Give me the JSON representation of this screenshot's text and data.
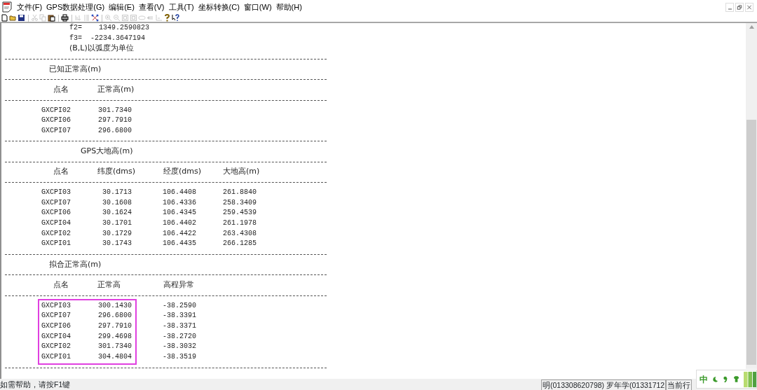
{
  "menu": [
    "文件(F)",
    "GPS数据处理(G)",
    "编辑(E)",
    "查看(V)",
    "工具(T)",
    "坐标转换(C)",
    "窗口(W)",
    "帮助(H)"
  ],
  "toolbar": [
    {
      "kind": "new",
      "disabled": false
    },
    {
      "kind": "open",
      "disabled": false
    },
    {
      "kind": "save",
      "disabled": false
    },
    {
      "kind": "separator"
    },
    {
      "kind": "cut",
      "disabled": true
    },
    {
      "kind": "copy",
      "disabled": true
    },
    {
      "kind": "paste",
      "disabled": false
    },
    {
      "kind": "separator"
    },
    {
      "kind": "print",
      "disabled": false
    },
    {
      "kind": "separator"
    },
    {
      "kind": "sort",
      "disabled": true
    },
    {
      "kind": "columns",
      "disabled": true
    },
    {
      "kind": "network",
      "disabled": false
    },
    {
      "kind": "separator"
    },
    {
      "kind": "zoom-in",
      "disabled": true
    },
    {
      "kind": "zoom-out",
      "disabled": true
    },
    {
      "kind": "frame",
      "disabled": true
    },
    {
      "kind": "frame",
      "disabled": true
    },
    {
      "kind": "ellipse",
      "disabled": true
    },
    {
      "kind": "arrows",
      "disabled": true
    },
    {
      "kind": "axis",
      "disabled": true
    },
    {
      "kind": "help",
      "disabled": false
    },
    {
      "kind": "context-help",
      "disabled": false
    }
  ],
  "report": {
    "header_lines": [
      "f2=    1349.2590823",
      "f3=  -2234.3647194",
      "(B,L)以弧度为单位"
    ],
    "sections": [
      {
        "title": "已知正常高(m)",
        "columns": [
          "点名",
          "正常高(m)"
        ],
        "rows": [
          [
            "GXCPI02",
            "301.7340"
          ],
          [
            "GXCPI06",
            "297.7910"
          ],
          [
            "GXCPI07",
            "296.6800"
          ]
        ],
        "highlighted": false
      },
      {
        "title": "GPS大地高(m)",
        "columns": [
          "点名",
          "纬度(dms)",
          "经度(dms)",
          "大地高(m)"
        ],
        "rows": [
          [
            "GXCPI03",
            "30.1713",
            "106.4408",
            "261.8840"
          ],
          [
            "GXCPI07",
            "30.1608",
            "106.4336",
            "258.3409"
          ],
          [
            "GXCPI06",
            "30.1624",
            "106.4345",
            "259.4539"
          ],
          [
            "GXCPI04",
            "30.1701",
            "106.4402",
            "261.1978"
          ],
          [
            "GXCPI02",
            "30.1729",
            "106.4422",
            "263.4308"
          ],
          [
            "GXCPI01",
            "30.1743",
            "106.4435",
            "266.1285"
          ]
        ],
        "highlighted": false
      },
      {
        "title": "拟合正常高(m)",
        "columns": [
          "点名",
          "正常高",
          "高程异常"
        ],
        "rows": [
          [
            "GXCPI03",
            "300.1430",
            "-38.2590"
          ],
          [
            "GXCPI07",
            "296.6800",
            "-38.3391"
          ],
          [
            "GXCPI06",
            "297.7910",
            "-38.3371"
          ],
          [
            "GXCPI04",
            "299.4698",
            "-38.2720"
          ],
          [
            "GXCPI02",
            "301.7340",
            "-38.3032"
          ],
          [
            "GXCPI01",
            "304.4804",
            "-38.3519"
          ]
        ],
        "highlighted": true
      }
    ]
  },
  "status_bar": [
    "如需帮助，请按F1键",
    "明(013308620798)  罗年学(01331712",
    "当前行"
  ],
  "ime_bar": {
    "label": "中"
  }
}
